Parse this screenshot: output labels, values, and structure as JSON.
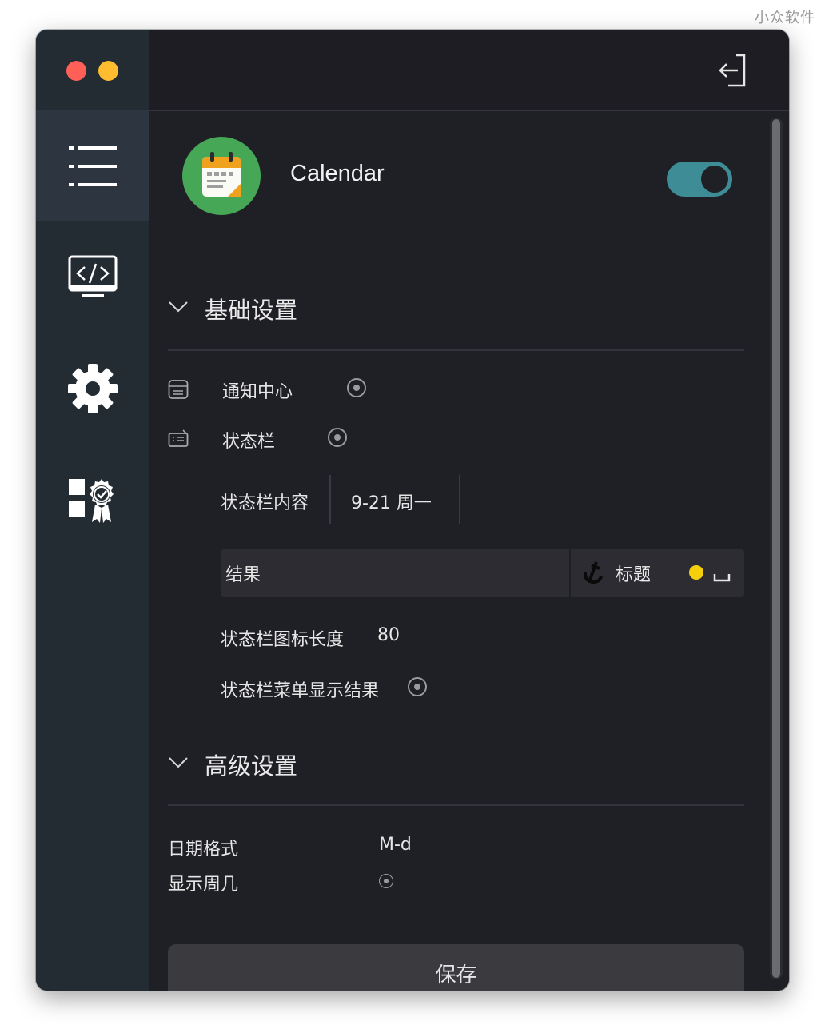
{
  "watermark": "小众软件",
  "sidebar": {
    "items": [
      {
        "icon": "list-icon",
        "active": true
      },
      {
        "icon": "code-monitor-icon",
        "active": false
      },
      {
        "icon": "gear-icon",
        "active": false
      },
      {
        "icon": "award-widgets-icon",
        "active": false
      }
    ]
  },
  "titlebar": {
    "exit_icon": "exit-icon"
  },
  "app": {
    "name": "Calendar",
    "icon": "calendar-icon",
    "enabled": true,
    "toggle_color": "#3e8c96"
  },
  "basic": {
    "title": "基础设置",
    "notification_center": "通知中心",
    "status_bar": "状态栏",
    "status_bar_content_label": "状态栏内容",
    "status_bar_content_value": "9-21 周一",
    "result_label": "结果",
    "title_label": "标题",
    "icon_length_label": "状态栏图标长度",
    "icon_length_value": "80",
    "menu_show_result": "状态栏菜单显示结果"
  },
  "advanced": {
    "title": "高级设置",
    "date_format_label": "日期格式",
    "date_format_value": "M-d",
    "show_weekday_label": "显示周几"
  },
  "save_label": "保存",
  "colors": {
    "accent_yellow": "#f5cf0c",
    "traffic_red": "#fe5f57",
    "traffic_yellow": "#febc2e"
  }
}
